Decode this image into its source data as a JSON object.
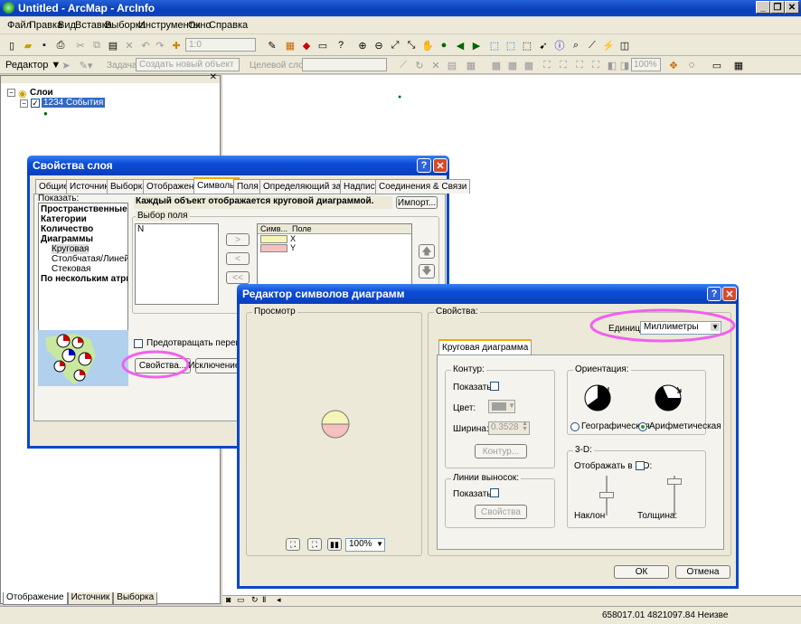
{
  "window": {
    "title": "Untitled - ArcMap - ArcInfo"
  },
  "menu": [
    "Файл",
    "Правка",
    "Вид",
    "Вставка",
    "Выборка",
    "Инструменты",
    "Окно",
    "Справка"
  ],
  "toolbar": {
    "scale_value": "1:0",
    "zoom_value": "100%"
  },
  "editor": {
    "label": "Редактор ▼",
    "task_label": "Задача:",
    "task_value": "Создать новый объект",
    "target_label": "Целевой слой:"
  },
  "toc": {
    "root": "Слои",
    "layer": "1234 События",
    "tabs": [
      "Отображение",
      "Источник",
      "Выборка"
    ]
  },
  "statusbar": {
    "coords": "658017.01  4821097.84 Неизве"
  },
  "layer_props": {
    "title": "Свойства слоя",
    "tabs": [
      "Общие",
      "Источник",
      "Выборка",
      "Отображение",
      "Символы",
      "Поля",
      "Определяющий запрос",
      "Надписи",
      "Соединения & Связи"
    ],
    "show_label": "Показать:",
    "tree": [
      "Пространственные объ",
      "Категории",
      "Количество",
      "Диаграммы",
      "Круговая",
      "Столбчатая/Линейчатая",
      "Стековая",
      "По нескольким атрибут"
    ],
    "description": "Каждый объект отображается круговой диаграммой.",
    "import_btn": "Импорт...",
    "field_select": "Выбор поля",
    "field_item": "N",
    "col_symbol": "Симв...",
    "col_field": "Поле",
    "fields": [
      "X",
      "Y"
    ],
    "move_right": ">",
    "move_left": "<",
    "move_all_left": "<<",
    "prevent_overlap": "Предотвращать перекрытие д",
    "properties_btn": "Свойства...",
    "exclusion_btn": "Исключение..."
  },
  "chart_editor": {
    "title": "Редактор символов диаграмм",
    "preview_label": "Просмотр",
    "zoom": "100%",
    "properties_label": "Свойства:",
    "units_label": "Единицы:",
    "units_value": "Миллиметры",
    "tab": "Круговая диаграмма",
    "outline": {
      "label": "Контур:",
      "show": "Показать:",
      "color": "Цвет:",
      "width": "Ширина:",
      "width_value": "0.3528",
      "btn": "Контур..."
    },
    "leaders": {
      "label": "Линии выносок:",
      "show": "Показать:",
      "btn": "Свойства"
    },
    "orientation": {
      "label": "Ориентация:",
      "geo": "Географическая",
      "arith": "Арифметическая"
    },
    "three_d": {
      "label": "3-D:",
      "show": "Отображать в 3-D:",
      "tilt": "Наклон",
      "thickness": "Толщина:"
    },
    "ok": "ОК",
    "cancel": "Отмена"
  },
  "colors": {
    "x_color": "#f5f5b8",
    "y_color": "#f5c0c0"
  }
}
